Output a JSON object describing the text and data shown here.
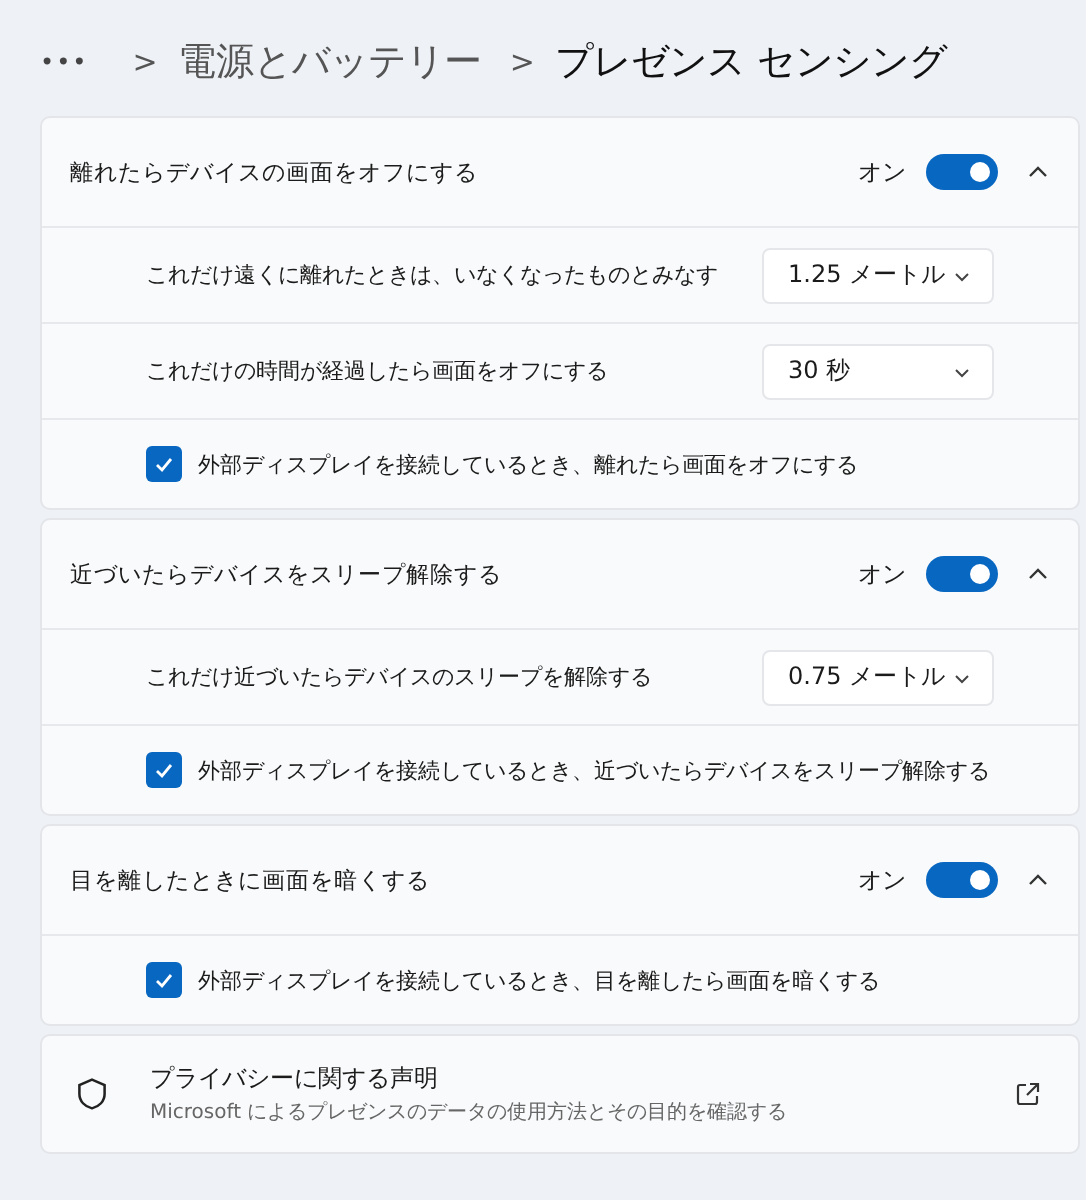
{
  "breadcrumb": {
    "more": "•••",
    "separators": [
      ">",
      ">"
    ],
    "parent": "電源とバッテリー",
    "current": "プレゼンス センシング"
  },
  "sections": [
    {
      "title": "離れたらデバイスの画面をオフにする",
      "toggle_label": "オン",
      "on": true,
      "expanded": true,
      "rows": [
        {
          "kind": "dropdown",
          "label": "これだけ遠くに離れたときは、いなくなったものとみなす",
          "value": "1.25 メートル"
        },
        {
          "kind": "dropdown",
          "label": "これだけの時間が経過したら画面をオフにする",
          "value": "30 秒"
        },
        {
          "kind": "checkbox",
          "label": "外部ディスプレイを接続しているとき、離れたら画面をオフにする",
          "checked": true
        }
      ]
    },
    {
      "title": "近づいたらデバイスをスリープ解除する",
      "toggle_label": "オン",
      "on": true,
      "expanded": true,
      "rows": [
        {
          "kind": "dropdown",
          "label": "これだけ近づいたらデバイスのスリープを解除する",
          "value": "0.75 メートル"
        },
        {
          "kind": "checkbox",
          "label": "外部ディスプレイを接続しているとき、近づいたらデバイスをスリープ解除する",
          "checked": true
        }
      ]
    },
    {
      "title": "目を離したときに画面を暗くする",
      "toggle_label": "オン",
      "on": true,
      "expanded": true,
      "rows": [
        {
          "kind": "checkbox",
          "label": "外部ディスプレイを接続しているとき、目を離したら画面を暗くする",
          "checked": true
        }
      ]
    }
  ],
  "privacy": {
    "title": "プライバシーに関する声明",
    "description": "Microsoft によるプレゼンスのデータの使用方法とその目的を確認する"
  }
}
